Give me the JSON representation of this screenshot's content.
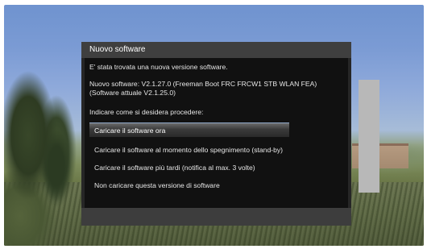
{
  "dialog": {
    "title": "Nuovo software",
    "message": "E' stata trovata una nuova versione software.",
    "new_software": "Nuovo software: V2.1.27.0 (Freeman Boot FRC FRCW1 STB WLAN FEA)",
    "current_software": "(Software attuale V2.1.25.0)",
    "prompt": "Indicare come si desidera procedere:",
    "options": [
      {
        "label": "Caricare il software ora",
        "selected": true
      },
      {
        "label": "Caricare il software al momento dello spegnimento (stand-by)",
        "selected": false
      },
      {
        "label": "Caricare il software più tardi (notifica al max. 3 volte)",
        "selected": false
      },
      {
        "label": "Non caricare questa versione di software",
        "selected": false
      }
    ]
  },
  "colors": {
    "dialog_bg": "#262626",
    "body_bg": "#111111",
    "highlight_border": "#8fa8c8"
  }
}
